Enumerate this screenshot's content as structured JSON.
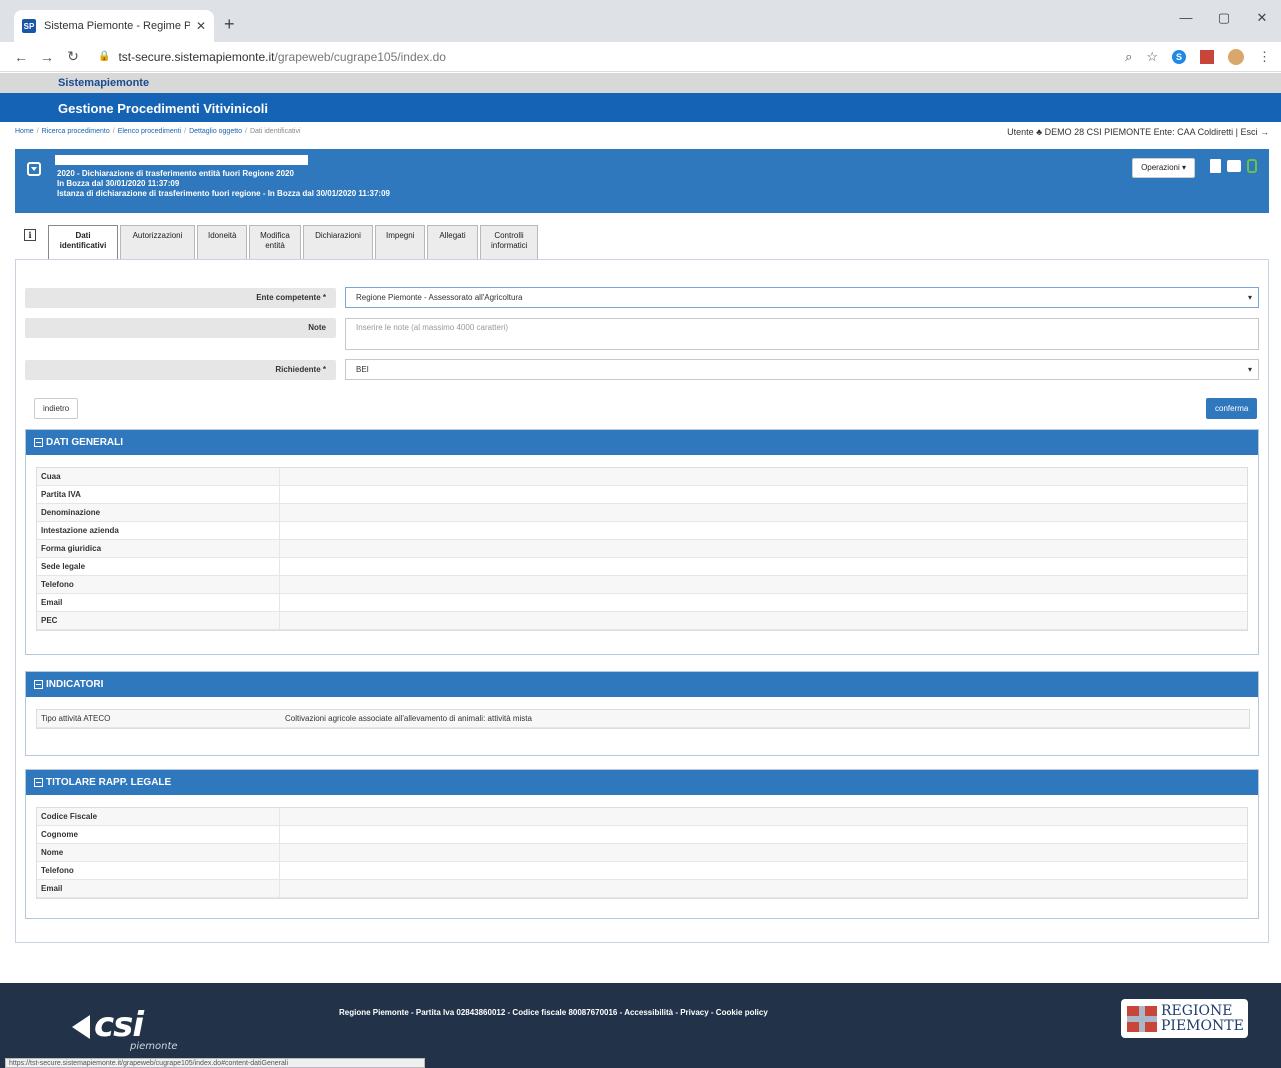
{
  "browser": {
    "tab_title": "Sistema Piemonte - Regime Paga",
    "favicon_text": "SP",
    "url_host": "tst-secure.sistemapiemonte.it",
    "url_path": "/grapeweb/cugrape105/index.do",
    "status_url": "https://tst-secure.sistemapiemonte.it/grapeweb/cugrape105/index.do#content-datiGenerali"
  },
  "site": {
    "top_title": "Sistemapiemonte",
    "band_title": "Gestione Procedimenti Vitivinicoli"
  },
  "breadcrumb": {
    "items": [
      "Home",
      "Ricerca procedimento",
      "Elenco procedimenti",
      "Dettaglio oggetto"
    ],
    "current": "Dati identificativi"
  },
  "user": {
    "text": "Utente ♣ DEMO 28 CSI PIEMONTE   Ente: CAA Coldiretti | Esci →"
  },
  "object": {
    "line1": "2020 - Dichiarazione di trasferimento entità fuori Regione 2020",
    "line2": "In Bozza dal 30/01/2020 11:37:09",
    "line3": "Istanza di dichiarazione di trasferimento fuori regione - In Bozza dal 30/01/2020 11:37:09",
    "operations_label": "Operazioni ▾"
  },
  "tabs": [
    {
      "label": "Dati\nidentificativi",
      "active": true
    },
    {
      "label": "Autorizzazioni",
      "active": false
    },
    {
      "label": "Idoneità",
      "active": false
    },
    {
      "label": "Modifica\nentità",
      "active": false
    },
    {
      "label": "Dichiarazioni",
      "active": false
    },
    {
      "label": "Impegni",
      "active": false
    },
    {
      "label": "Allegati",
      "active": false
    },
    {
      "label": "Controlli\ninformatici",
      "active": false
    }
  ],
  "form": {
    "ente_label": "Ente competente *",
    "ente_value": "Regione Piemonte - Assessorato all'Agricoltura",
    "note_label": "Note",
    "note_placeholder": "Inserire le note (al massimo 4000 caratteri)",
    "richiedente_label": "Richiedente *",
    "richiedente_value": "BEI",
    "back_label": "indietro",
    "confirm_label": "conferma"
  },
  "sections": {
    "dati_generali": {
      "title": "DATI GENERALI",
      "rows": [
        "Cuaa",
        "Partita IVA",
        "Denominazione",
        "Intestazione azienda",
        "Forma giuridica",
        "Sede legale",
        "Telefono",
        "Email",
        "PEC"
      ]
    },
    "indicatori": {
      "title": "INDICATORI",
      "row_label": "Tipo attività ATECO",
      "row_value": "Coltivazioni agricole associate all'allevamento di animali: attività mista"
    },
    "titolare": {
      "title": "TITOLARE RAPP. LEGALE",
      "rows": [
        "Codice Fiscale",
        "Cognome",
        "Nome",
        "Telefono",
        "Email"
      ]
    }
  },
  "footer": {
    "text": "Regione Piemonte - Partita Iva 02843860012 - Codice fiscale 80087670016 - Accessibilità - Privacy - Cookie policy",
    "csi_logo": "csi",
    "csi_sub": "piemonte",
    "regione_line1": "REGIONE",
    "regione_line2": "PIEMONTE"
  }
}
